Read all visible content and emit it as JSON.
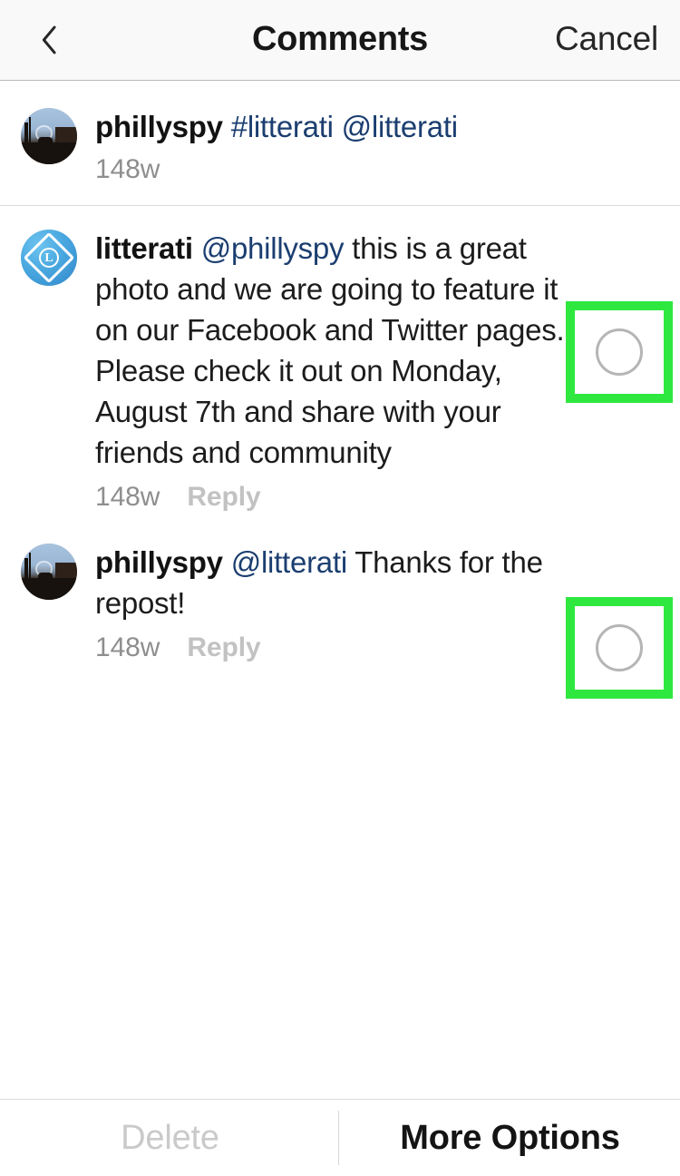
{
  "header": {
    "back_icon": "chevron-left-icon",
    "title": "Comments",
    "cancel_label": "Cancel"
  },
  "comments": [
    {
      "avatar_type": "photo",
      "username": "phillyspy",
      "mention": "#litterati @litterati",
      "text": "",
      "timestamp": "148w",
      "reply_label": "",
      "selectable": false
    },
    {
      "avatar_type": "logo",
      "username": "litterati",
      "mention": "@phillyspy",
      "text": " this is a great photo and we are going to feature it on our Facebook and Twitter pages. Please check it out on Monday, August 7th and share with your friends and community",
      "timestamp": "148w",
      "reply_label": "Reply",
      "selectable": true
    },
    {
      "avatar_type": "photo",
      "username": "phillyspy",
      "mention": "@litterati",
      "text": " Thanks for the repost!",
      "timestamp": "148w",
      "reply_label": "Reply",
      "selectable": true
    }
  ],
  "selection": {
    "highlight_color": "#2fe83f",
    "circle_border_color": "#b5b5b5",
    "checked": false
  },
  "logo_avatar": {
    "letter": "L"
  },
  "bottom_bar": {
    "delete_label": "Delete",
    "more_options_label": "More Options"
  },
  "colors": {
    "link": "#1b3e70",
    "text": "#1c1c1c",
    "muted": "#8e8e8e",
    "reply": "#c2c2c2",
    "header_bg": "#f9f9f9"
  }
}
